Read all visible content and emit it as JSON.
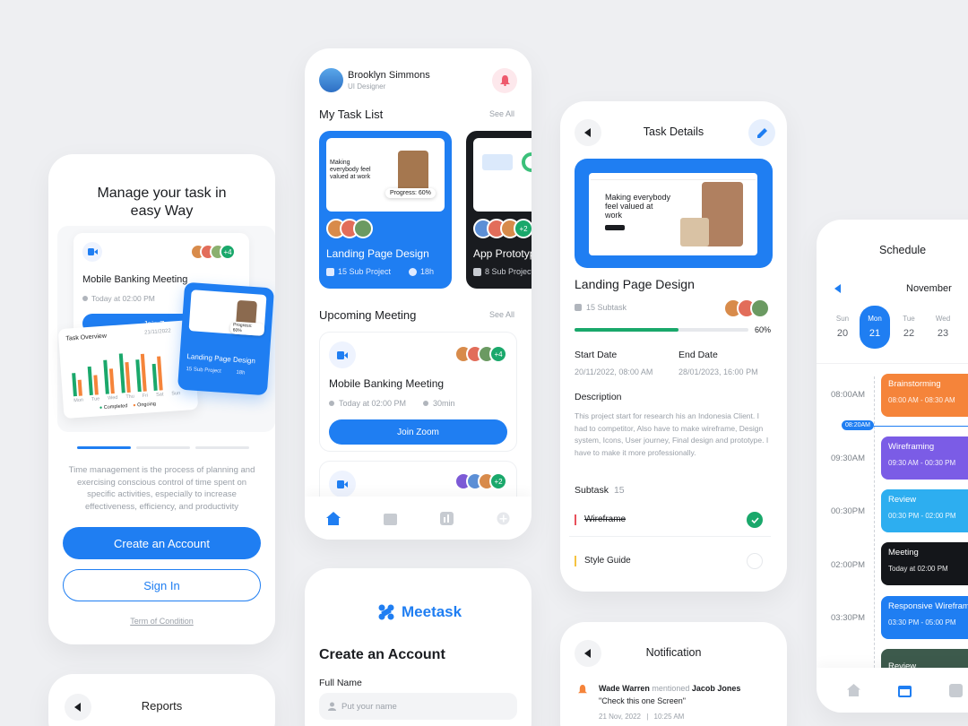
{
  "onboarding": {
    "headline_l1": "Manage your task in",
    "headline_l2": "easy Way",
    "meeting_title": "Mobile Banking Meeting",
    "meeting_time": "Today at 02:00 PM",
    "join_label": "Join Zoom",
    "avatar_more": "+4",
    "overview_title": "Task Overview",
    "overview_date": "21/11/2022",
    "overview_legend": [
      "Completed",
      "Ongoing"
    ],
    "overview_days": [
      "Mon",
      "Tue",
      "Wed",
      "Thu",
      "Fri",
      "Sat",
      "Sun"
    ],
    "mini_card_title": "Landing Page Design",
    "mini_card_sub": "15 Sub Project",
    "mini_card_hours": "18h",
    "mini_progress": "Progress: 60%",
    "description": "Time management is the process of planning and exercising conscious control of time spent on specific activities, especially to increase effectiveness, efficiency, and productivity",
    "create_account": "Create an Account",
    "sign_in": "Sign In",
    "terms": "Term of Condition"
  },
  "reports": {
    "title": "Reports"
  },
  "home": {
    "user_name": "Brooklyn Simmons",
    "user_role": "UI Designer",
    "task_list_title": "My Task List",
    "see_all": "See All",
    "task1": {
      "title": "Landing Page Design",
      "sub": "15 Sub Project",
      "hours": "18h",
      "progress": "Progress: 60%",
      "shot_text": "Making everybody feel valued at work"
    },
    "task2": {
      "title": "App Prototype",
      "sub": "8 Sub Project",
      "avatar_more": "+2"
    },
    "upcoming_title": "Upcoming Meeting",
    "meeting_title": "Mobile Banking Meeting",
    "meeting_time": "Today at 02:00 PM",
    "meeting_duration": "30min",
    "join_label": "Join Zoom",
    "avatar_more": "+4",
    "avatar_more2": "+2"
  },
  "signup": {
    "brand": "Meetask",
    "title": "Create an Account",
    "full_name_label": "Full Name",
    "full_name_placeholder": "Put your name"
  },
  "task_details": {
    "header": "Task Details",
    "hero_text": "Making everybody feel valued at work",
    "title": "Landing Page Design",
    "subtask_count_label": "15 Subtask",
    "progress": 0.6,
    "progress_label": "60%",
    "start_label": "Start Date",
    "start_value": "20/11/2022, 08:00 AM",
    "end_label": "End Date",
    "end_value": "28/01/2023, 16:00 PM",
    "description_label": "Description",
    "description": "This project start for research his an Indonesia Client. I had to competitor, Also have to make wireframe, Design system, Icons, User journey, Final design and prototype. I have to make it more professionally.",
    "subtask_label": "Subtask",
    "subtask_count": "15",
    "subtasks": [
      {
        "name": "Wireframe",
        "done": true,
        "color": "#e8505b"
      },
      {
        "name": "Style Guide",
        "done": false,
        "color": "#f5c341"
      }
    ]
  },
  "notification": {
    "header": "Notification",
    "actor": "Wade Warren",
    "verb": "mentioned",
    "target": "Jacob Jones",
    "quote": "\"Check this one Screen\"",
    "date": "21 Nov, 2022",
    "time": "10:25 AM"
  },
  "schedule": {
    "title": "Schedule",
    "month": "November",
    "days": [
      {
        "dow": "Sun",
        "num": "20"
      },
      {
        "dow": "Mon",
        "num": "21"
      },
      {
        "dow": "Tue",
        "num": "22"
      },
      {
        "dow": "Wed",
        "num": "23"
      }
    ],
    "now_time": "08:20AM",
    "times": [
      "08:00AM",
      "09:30AM",
      "00:30PM",
      "02:00PM",
      "03:30PM"
    ],
    "events": [
      {
        "name": "Brainstorming",
        "time": "08:00 AM - 08:30 AM",
        "color": "#f5843a"
      },
      {
        "name": "Wireframing",
        "time": "09:30 AM - 00:30 PM",
        "color": "#7b5ce6"
      },
      {
        "name": "Review",
        "time": "00:30 PM - 02:00 PM",
        "color": "#2daef0"
      },
      {
        "name": "Meeting",
        "time": "Today at 02:00 PM",
        "color": "#14161a"
      },
      {
        "name": "Responsive Wireframe",
        "time": "03:30 PM - 05:00 PM",
        "color": "#1f7ef2"
      },
      {
        "name": "Review",
        "time": "",
        "color": "#3d5a4c"
      }
    ]
  },
  "colors": {
    "accent": "#1f7ef2",
    "success": "#1aa86b"
  }
}
